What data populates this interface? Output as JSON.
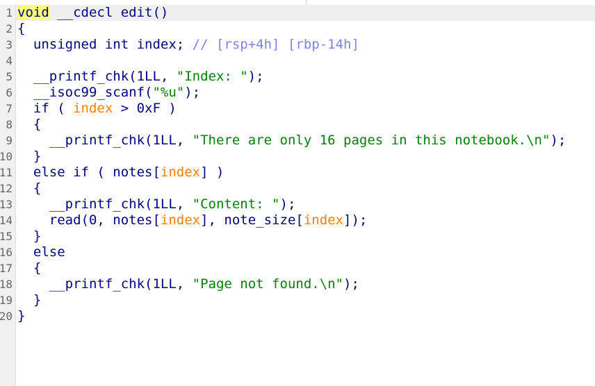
{
  "line_numbers": [
    "1",
    "2",
    "3",
    "4",
    "5",
    "6",
    "7",
    "8",
    "9",
    "10",
    "11",
    "12",
    "13",
    "14",
    "15",
    "16",
    "17",
    "18",
    "19",
    "20"
  ],
  "code": {
    "l1": {
      "keyword": "void",
      "rest": " __cdecl edit()"
    },
    "l2": {
      "text": "{"
    },
    "l3": {
      "text": "  unsigned int index; ",
      "comment": "// [rsp+4h] [rbp-14h]"
    },
    "l4": {
      "text": ""
    },
    "l5": {
      "pre": "  __printf_chk(1LL, ",
      "str": "\"Index: \"",
      "post": ");"
    },
    "l6": {
      "pre": "  __isoc99_scanf(",
      "str": "\"%u\"",
      "post": ");"
    },
    "l7": {
      "pre": "  if ( ",
      "var": "index",
      "post": " > 0xF )"
    },
    "l8": {
      "text": "  {"
    },
    "l9": {
      "pre": "    __printf_chk(1LL, ",
      "str": "\"There are only 16 pages in this notebook.\\n\"",
      "post": ");"
    },
    "l10": {
      "text": "  }"
    },
    "l11": {
      "pre": "  else if ( notes[",
      "var": "index",
      "post": "] )"
    },
    "l12": {
      "text": "  {"
    },
    "l13": {
      "pre": "    __printf_chk(1LL, ",
      "str": "\"Content: \"",
      "post": ");"
    },
    "l14": {
      "pre": "    read(0, notes[",
      "var1": "index",
      "mid": "], note_size[",
      "var2": "index",
      "post": "]);"
    },
    "l15": {
      "text": "  }"
    },
    "l16": {
      "text": "  else"
    },
    "l17": {
      "text": "  {"
    },
    "l18": {
      "pre": "    __printf_chk(1LL, ",
      "str": "\"Page not found.\\n\"",
      "post": ");"
    },
    "l19": {
      "text": "  }"
    },
    "l20": {
      "text": "}"
    }
  },
  "colors": {
    "code_default": "#000080",
    "string": "#008000",
    "variable": "#ff8000",
    "comment": "#7f7fff",
    "keyword_highlight": "#fdfd7a",
    "gutter_bg": "#f0f0f0"
  }
}
